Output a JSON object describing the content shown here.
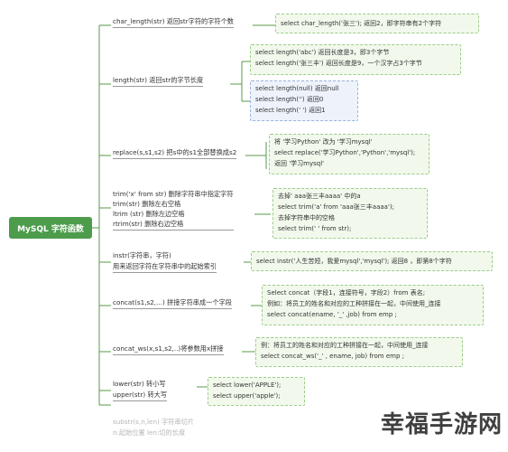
{
  "root": "MySQL 字符函数",
  "branches": {
    "char_length": {
      "label": "char_length(str)   返回str字符的字符个数",
      "notes": [
        "select char_length('张三');   返回2，即字符串有2个字符"
      ]
    },
    "length": {
      "label": "length(str)          返回str的字节长度",
      "notes_a": [
        "select length('abc')   返回长度是3，即3个字节",
        "select length('张三丰')   返回长度是9，一个汉字占3个字节"
      ],
      "notes_b": [
        "select length(null)  返回null",
        "select length('')  返回0",
        "select length(' ')  返回1"
      ]
    },
    "replace": {
      "label": "replace(s,s1,s2) 把s中的s1全部替换成s2",
      "notes": [
        "将 '学习Python' 改为 '学习mysql'",
        "select replace('学习Python','Python','mysql');",
        "返回 '学习mysql'"
      ]
    },
    "trim": {
      "labels": [
        "trim('x' from str)   删除字符串中指定字符",
        "trim(str)      删除左右空格",
        "ltrim (str)  删除左边空格",
        "rtrim(str)    删除右边空格"
      ],
      "notes": [
        "去掉' aaa张三丰aaaa' 中的a",
        "select trim('a' from 'aaa张三丰aaaa');",
        "去掉字符串中的空格",
        "select trim('  ' from str);"
      ]
    },
    "instr": {
      "labels": [
        "instr(字符串，字符)",
        "用来返回字符在字符串中的起始索引"
      ],
      "notes": [
        "select instr('人生苦短，我爱mysql','mysql');   返回8 ，即第8个字符"
      ]
    },
    "concat": {
      "label": "concat(s1,s2,...) 拼接字符串成一个字段",
      "notes": [
        "Select concat（字段1，连接符号，字段2）from 表名;",
        "例如：将员工的姓名和对应的工种拼接在一起，中间使用_连接",
        "select concat(ename, '_' ,job) from emp ;"
      ]
    },
    "concat_ws": {
      "label": "concat_ws(x,s1,s2,..)将参数用x拼接",
      "notes": [
        "例：将员工的姓名和对应的工种拼接在一起，中间使用_连接",
        "select concat_ws('_' , ename, job) from emp ;"
      ]
    },
    "case": {
      "labels": [
        "lower(str)         转小写",
        "upper(str)         转大写"
      ],
      "notes": [
        "select lower('APPLE');",
        "select upper('apple');"
      ]
    },
    "substr": {
      "labels": [
        "substr(s,n,len)  字符串切片",
        "n:起始位置 len:切的长度"
      ]
    }
  },
  "watermark": "幸福手游网",
  "colors": {
    "root_bg": "#4c9c4c",
    "line": "#5a9a4a",
    "note_border": "#9ccc8a",
    "note_bg": "#f2f9ec",
    "note_blue_border": "#98b4da",
    "note_blue_bg": "#eef3fb"
  }
}
